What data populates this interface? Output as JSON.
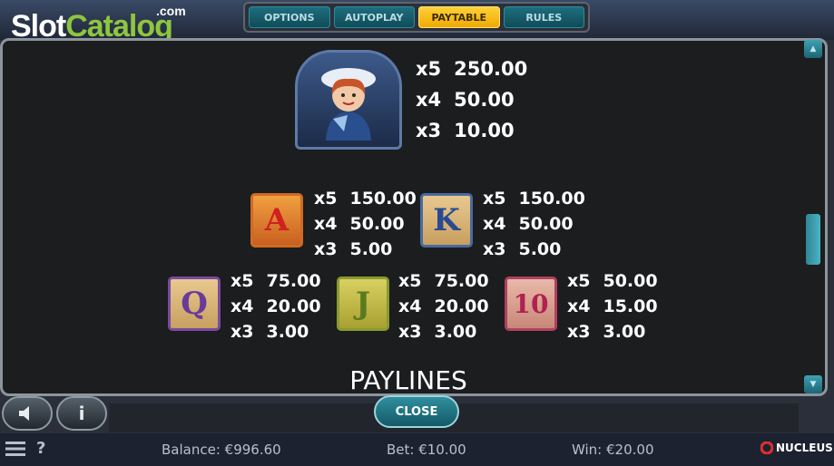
{
  "logo": {
    "slot": "Slot",
    "catalog": "Catalog",
    "com": ".com"
  },
  "tabs": [
    {
      "label": "OPTIONS",
      "active": false
    },
    {
      "label": "AUTOPLAY",
      "active": false
    },
    {
      "label": "PAYTABLE",
      "active": true
    },
    {
      "label": "RULES",
      "active": false
    }
  ],
  "paytable": {
    "hero": {
      "pays": [
        "x5",
        "250.00",
        "x4",
        "50.00",
        "x3",
        "10.00"
      ]
    },
    "a": {
      "letter": "A",
      "pays": [
        "x5",
        "150.00",
        "x4",
        "50.00",
        "x3",
        "5.00"
      ]
    },
    "k": {
      "letter": "K",
      "pays": [
        "x5",
        "150.00",
        "x4",
        "50.00",
        "x3",
        "5.00"
      ]
    },
    "q": {
      "letter": "Q",
      "pays": [
        "x5",
        "75.00",
        "x4",
        "20.00",
        "x3",
        "3.00"
      ]
    },
    "j": {
      "letter": "J",
      "pays": [
        "x5",
        "75.00",
        "x4",
        "20.00",
        "x3",
        "3.00"
      ]
    },
    "ten": {
      "letter": "10",
      "pays": [
        "x5",
        "50.00",
        "x4",
        "15.00",
        "x3",
        "3.00"
      ]
    }
  },
  "section_title": "PAYLINES",
  "buttons": {
    "close": "CLOSE",
    "info": "i",
    "help": "?"
  },
  "footer": {
    "balance": "Balance: €996.60",
    "bet": "Bet: €10.00",
    "win": "Win: €20.00",
    "brand": "NUCLEUS"
  },
  "colors": {
    "accent": "#ffc21a",
    "panel": "#1b1d1f",
    "teal": "#1f6f80"
  }
}
